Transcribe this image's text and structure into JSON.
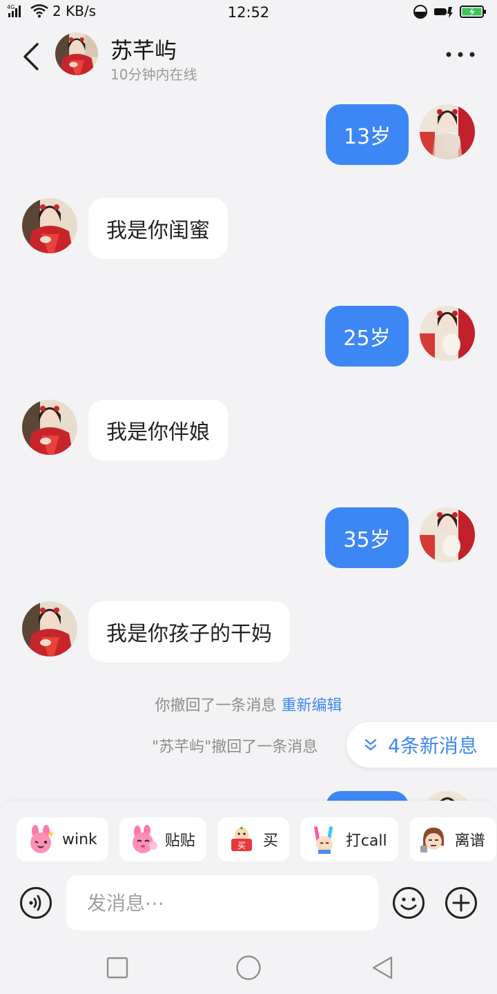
{
  "status_bar": {
    "network_type": "4G",
    "speed": "2 KB/s",
    "time": "12:52"
  },
  "header": {
    "contact_name": "苏芊屿",
    "online_status": "10分钟内在线"
  },
  "messages": [
    {
      "direction": "outgoing",
      "text": "13岁"
    },
    {
      "direction": "incoming",
      "text": "我是你闺蜜"
    },
    {
      "direction": "outgoing",
      "text": "25岁"
    },
    {
      "direction": "incoming",
      "text": "我是你伴娘"
    },
    {
      "direction": "outgoing",
      "text": "35岁"
    },
    {
      "direction": "incoming",
      "text": "我是你孩子的干妈"
    }
  ],
  "system": {
    "self_recall_text": "你撤回了一条消息",
    "reedit_link": "重新编辑",
    "other_recall_text": "\"苏芊屿\"撤回了一条消息"
  },
  "new_messages_label": "4条新消息",
  "stickers": [
    {
      "label": "wink",
      "icon": "pink-rabbit-wink-sticker"
    },
    {
      "label": "贴贴",
      "icon": "pink-rabbit-cuddle-sticker"
    },
    {
      "label": "买",
      "icon": "buy-sign-sticker"
    },
    {
      "label": "打call",
      "icon": "glowstick-sticker"
    },
    {
      "label": "离谱",
      "icon": "speechless-face-sticker"
    }
  ],
  "composer": {
    "placeholder": "发消息⋯"
  },
  "colors": {
    "accent": "#3d87f5",
    "background": "#f3f3f5",
    "bubble_in": "#ffffff"
  }
}
